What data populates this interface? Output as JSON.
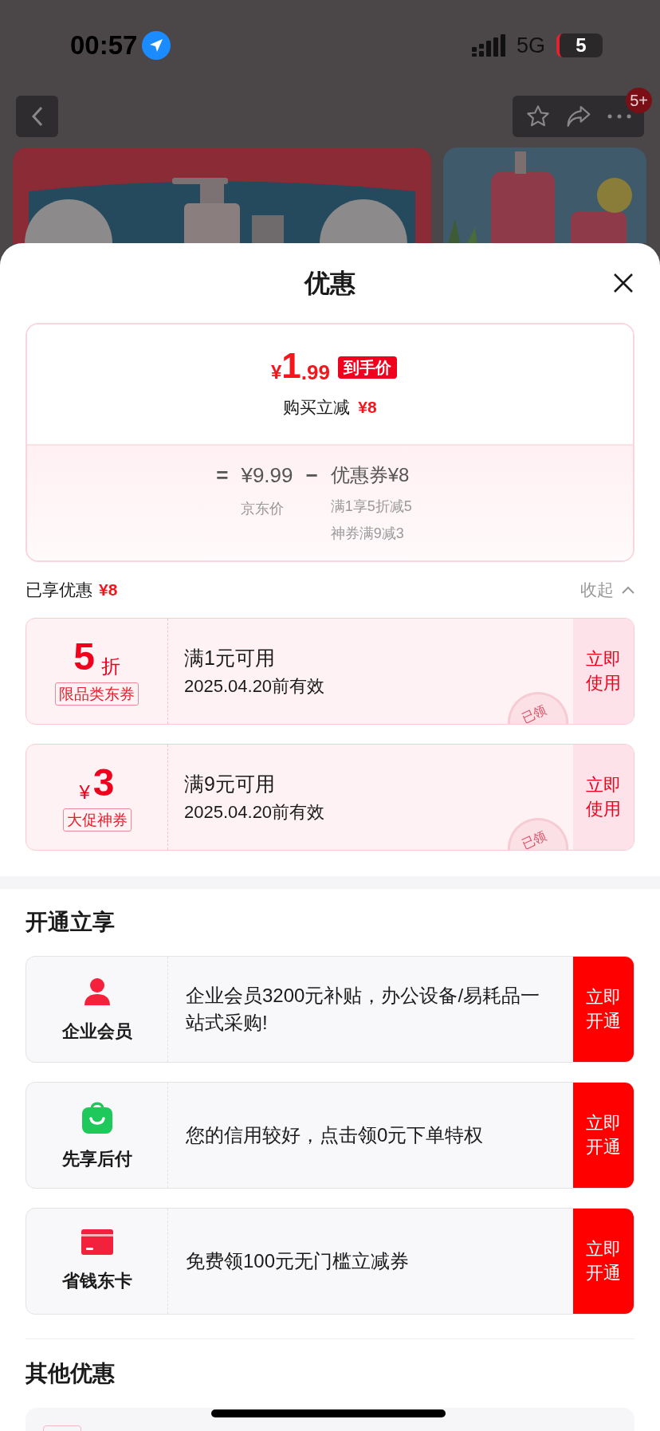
{
  "status_bar": {
    "time": "00:57",
    "network": "5G",
    "battery": "5"
  },
  "nav": {
    "badge": "5+"
  },
  "sheet": {
    "title": "优惠",
    "price_card": {
      "currency": "¥",
      "price_int": "1",
      "price_dec": ".99",
      "price_label": "到手价",
      "reduction_label": "购买立减",
      "reduction_amount": "¥8",
      "equals": "=",
      "jd_price": "¥9.99",
      "jd_price_label": "京东价",
      "minus": "−",
      "coupon_total": "优惠券¥8",
      "coupon_details": [
        "满1享5折减5",
        "神券满9减3"
      ]
    },
    "enjoyed": {
      "label": "已享优惠",
      "amount": "¥8",
      "collapse": "收起"
    },
    "coupons": [
      {
        "kind": "discount",
        "value": "5",
        "unit": "折",
        "tag": "限品类东券",
        "condition": "满1元可用",
        "expiry": "2025.04.20前有效",
        "action": "立即使用",
        "stamp": "已领"
      },
      {
        "kind": "cash",
        "value": "3",
        "unit": "¥",
        "tag": "大促神券",
        "condition": "满9元可用",
        "expiry": "2025.04.20前有效",
        "action": "立即使用",
        "stamp": "已领"
      }
    ],
    "membership": {
      "title": "开通立享",
      "items": [
        {
          "kind": "member",
          "name": "企业会员",
          "description": "企业会员3200元补贴，办公设备/易耗品一站式采购!",
          "action": "立即开通"
        },
        {
          "kind": "paylater",
          "name": "先享后付",
          "description": "您的信用较好，点击领0元下单特权",
          "action": "立即开通"
        },
        {
          "kind": "card",
          "name": "省钱东卡",
          "description": "免费领100元无门槛立减券",
          "action": "立即开通"
        }
      ]
    },
    "other": {
      "title": "其他优惠"
    }
  }
}
